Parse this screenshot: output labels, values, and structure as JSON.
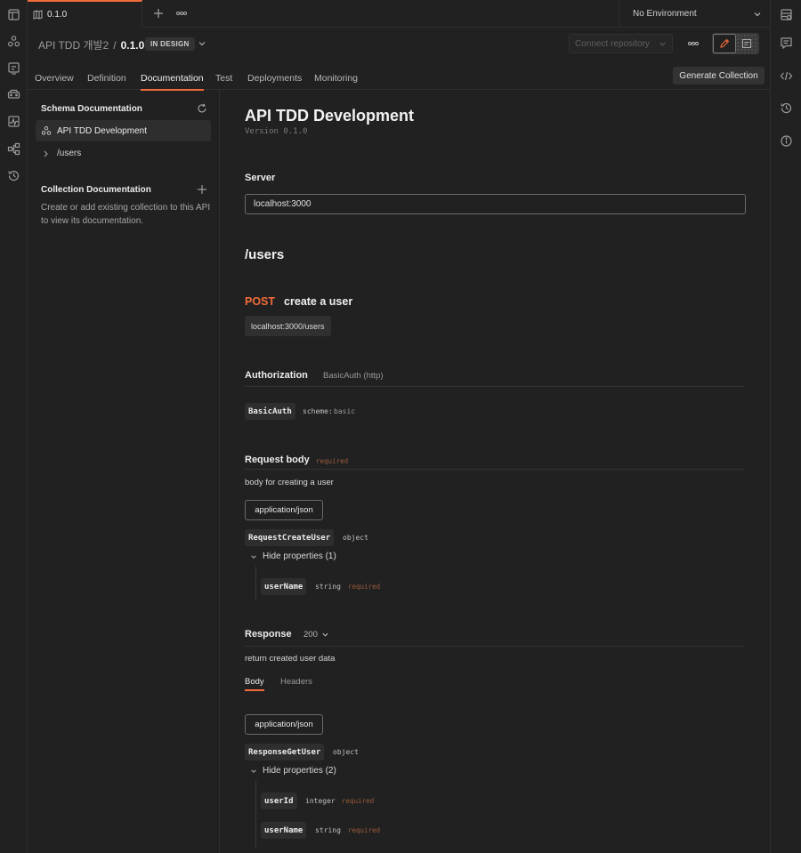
{
  "tabbar": {
    "active_tab_label": "0.1.0",
    "environment": "No Environment"
  },
  "header": {
    "api_name": "API TDD 개발2",
    "separator": "/",
    "version": "0.1.0",
    "status_badge": "IN DESIGN",
    "connect_repository": "Connect repository"
  },
  "subtabs": {
    "items": [
      "Overview",
      "Definition",
      "Documentation",
      "Test",
      "Deployments",
      "Monitoring"
    ],
    "active": "Documentation",
    "generate_button": "Generate Collection"
  },
  "sidebar": {
    "schema_title": "Schema Documentation",
    "schema_item": "API TDD Development",
    "schema_sub_item": "/users",
    "collection_title": "Collection Documentation",
    "collection_desc": "Create or add existing collection to this API to view its documentation."
  },
  "main": {
    "title": "API TDD Development",
    "version_text": "Version 0.1.0",
    "server_label": "Server",
    "server_value": "localhost:3000",
    "path_heading": "/users",
    "method": "POST",
    "summary": "create a user",
    "url": "localhost:3000/users",
    "auth": {
      "label": "Authorization",
      "type": "BasicAuth (http)",
      "scheme_name": "BasicAuth",
      "scheme_key": "scheme:",
      "scheme_value": "basic"
    },
    "request_body": {
      "label": "Request body",
      "required": "required",
      "description": "body for creating a user",
      "media_type": "application/json",
      "schema_name": "RequestCreateUser",
      "schema_type": "object",
      "toggle": "Hide properties (1)",
      "props": [
        {
          "name": "userName",
          "type": "string",
          "required": "required"
        }
      ]
    },
    "response": {
      "label": "Response",
      "status": "200",
      "description": "return created user data",
      "tab_body": "Body",
      "tab_headers": "Headers",
      "media_type": "application/json",
      "schema_name": "ResponseGetUser",
      "schema_type": "object",
      "toggle": "Hide properties (2)",
      "props": [
        {
          "name": "userId",
          "type": "integer",
          "required": "required"
        },
        {
          "name": "userName",
          "type": "string",
          "required": "required"
        }
      ]
    }
  },
  "colors": {
    "accent": "#f26b3a",
    "background": "#212121",
    "border": "#2f2f2f"
  }
}
